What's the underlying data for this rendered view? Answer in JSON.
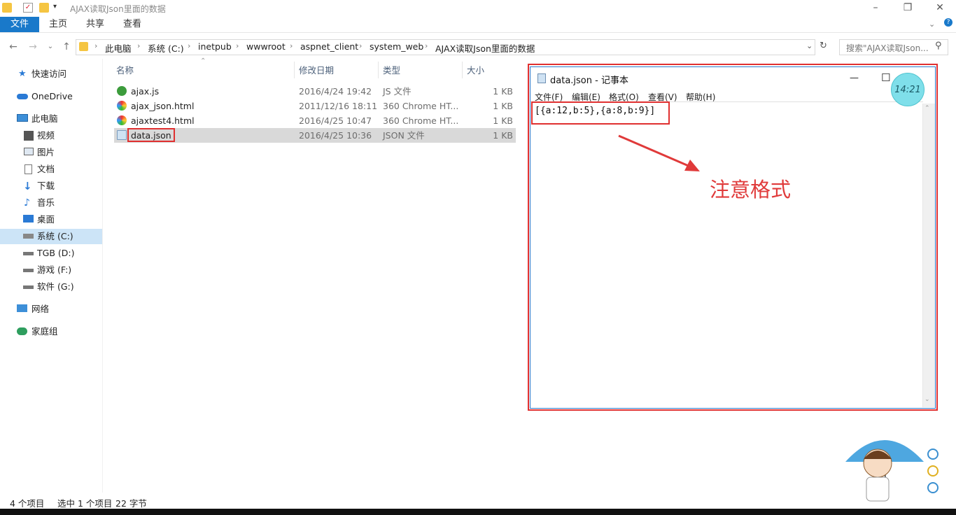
{
  "window": {
    "title": "AJAX读取Json里面的数据",
    "controls": {
      "minimize": "–",
      "maximize": "❐",
      "close": "✕"
    }
  },
  "ribbon": {
    "tabs": [
      "文件",
      "主页",
      "共享",
      "查看"
    ],
    "expand_icon": "chevron-down-icon",
    "help_icon": "?"
  },
  "address": {
    "crumbs": [
      "此电脑",
      "系统 (C:)",
      "inetpub",
      "wwwroot",
      "aspnet_client",
      "system_web",
      "AJAX读取Json里面的数据"
    ],
    "search_placeholder": "搜索\"AJAX读取Json..."
  },
  "sidebar": {
    "items": [
      {
        "label": "快速访问",
        "icon": "star-icon"
      },
      {
        "label": "OneDrive",
        "icon": "cloud-icon"
      },
      {
        "label": "此电脑",
        "icon": "computer-icon"
      },
      {
        "label": "视频",
        "icon": "video-icon"
      },
      {
        "label": "图片",
        "icon": "picture-icon"
      },
      {
        "label": "文档",
        "icon": "document-icon"
      },
      {
        "label": "下载",
        "icon": "download-icon"
      },
      {
        "label": "音乐",
        "icon": "music-icon"
      },
      {
        "label": "桌面",
        "icon": "desktop-icon"
      },
      {
        "label": "系统 (C:)",
        "icon": "drive-icon"
      },
      {
        "label": "TGB (D:)",
        "icon": "drive-icon"
      },
      {
        "label": "游戏 (F:)",
        "icon": "drive-icon"
      },
      {
        "label": "软件 (G:)",
        "icon": "drive-icon"
      },
      {
        "label": "网络",
        "icon": "network-icon"
      },
      {
        "label": "家庭组",
        "icon": "homegroup-icon"
      }
    ]
  },
  "filelist": {
    "columns": [
      "名称",
      "修改日期",
      "类型",
      "大小"
    ],
    "rows": [
      {
        "name": "ajax.js",
        "date": "2016/4/24 19:42",
        "type": "JS 文件",
        "size": "1 KB"
      },
      {
        "name": "ajax_json.html",
        "date": "2011/12/16 18:11",
        "type": "360 Chrome HT...",
        "size": "1 KB"
      },
      {
        "name": "ajaxtest4.html",
        "date": "2016/4/25 10:47",
        "type": "360 Chrome HT...",
        "size": "1 KB"
      },
      {
        "name": "data.json",
        "date": "2016/4/25 10:36",
        "type": "JSON 文件",
        "size": "1 KB"
      }
    ]
  },
  "status": {
    "count": "4 个项目",
    "selection": "选中 1 个项目",
    "size": "22 字节"
  },
  "notepad": {
    "title": "data.json - 记事本",
    "menu": [
      "文件(F)",
      "编辑(E)",
      "格式(O)",
      "查看(V)",
      "帮助(H)"
    ],
    "content": "[{a:12,b:5},{a:8,b:9}]",
    "controls": {
      "minimize": "—",
      "maximize": "☐",
      "close": "✕"
    }
  },
  "clock": {
    "time": "14:21"
  },
  "annotation": {
    "text": "注意格式",
    "color": "#e03a3a"
  },
  "colors": {
    "accent": "#1979ca",
    "highlight_box": "#e03030",
    "selected_row": "#d9d9d9"
  }
}
